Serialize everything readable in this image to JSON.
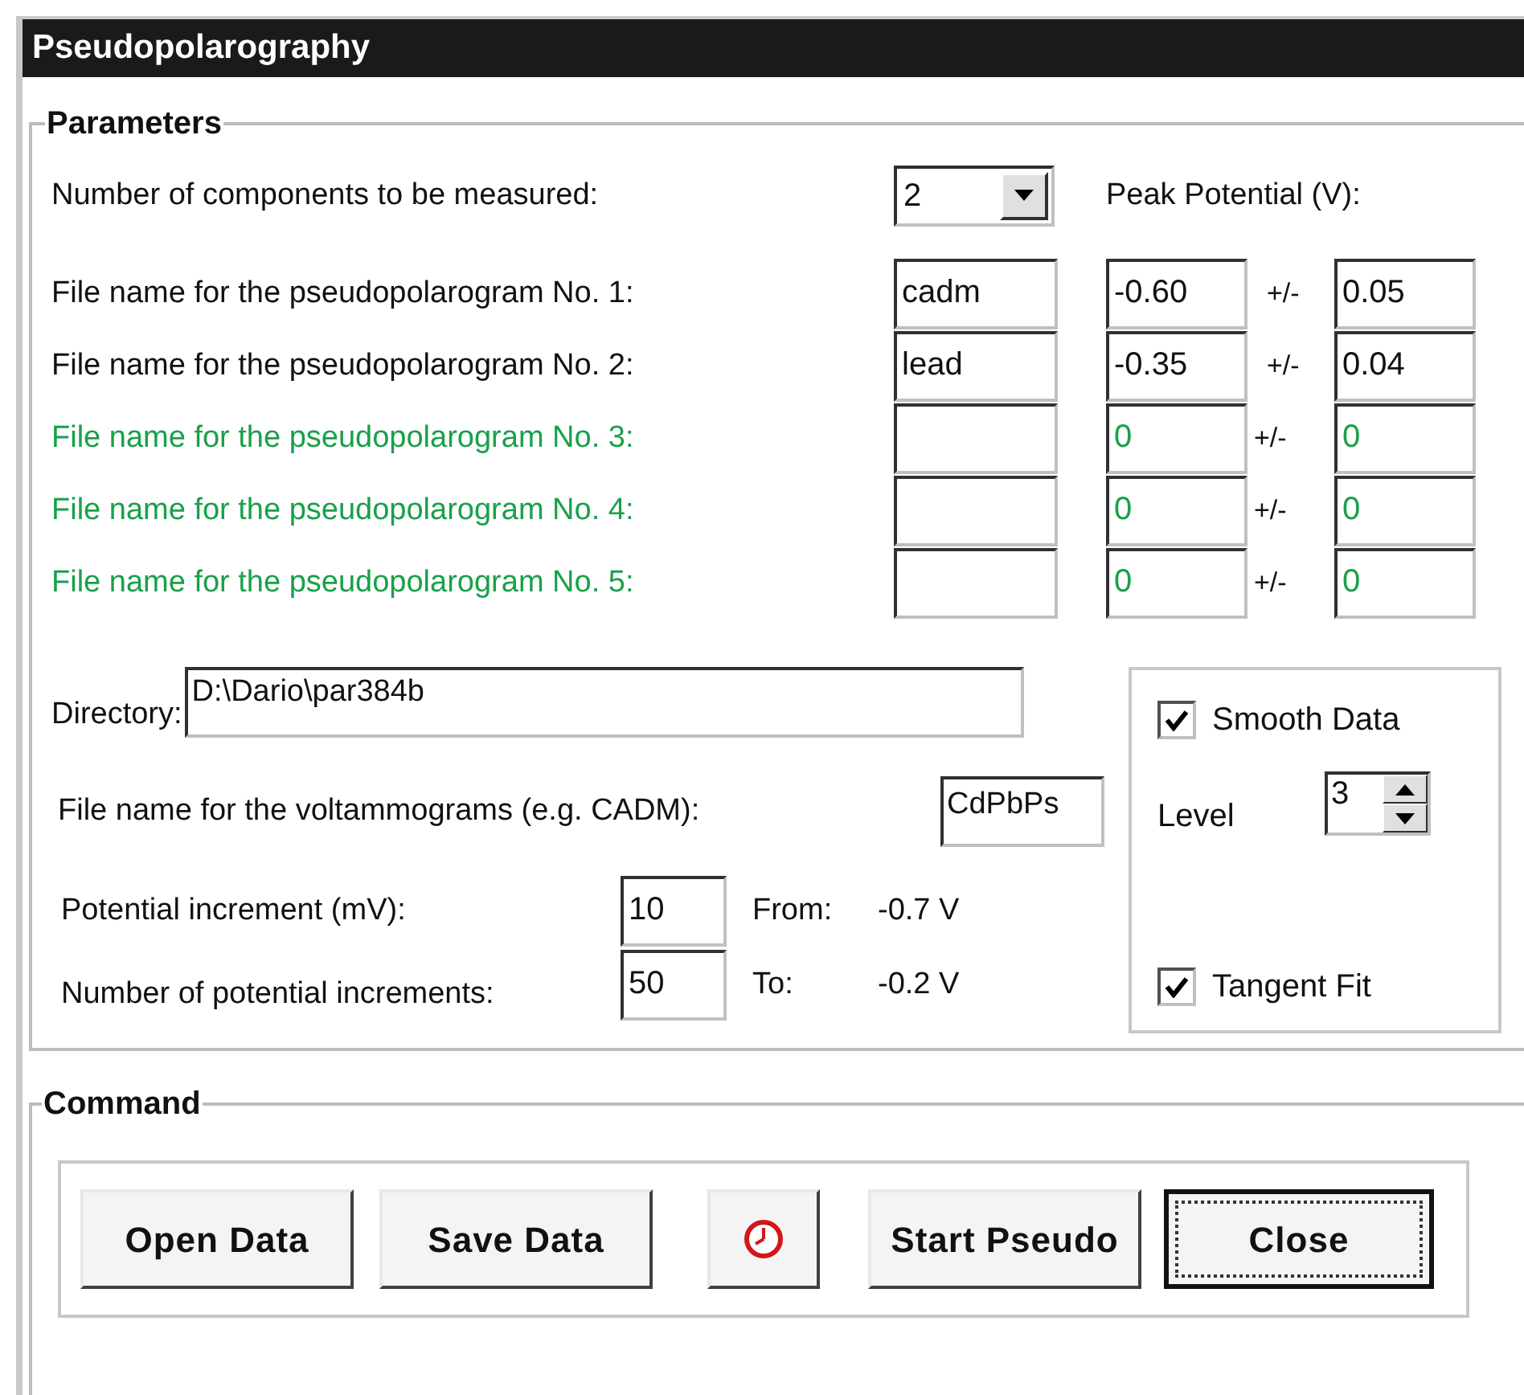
{
  "window": {
    "title": "Pseudopolarography"
  },
  "parameters": {
    "title": "Parameters",
    "components": {
      "label": "Number of components to be measured:",
      "value": "2"
    },
    "peak_header": "Peak Potential (V):",
    "files": [
      {
        "label": "File name for the pseudopolarogram No. 1:",
        "file": "cadm",
        "peak": "-0.60",
        "separator": "+/-",
        "tolerance": "0.05",
        "disabled": false
      },
      {
        "label": "File name for the pseudopolarogram No. 2:",
        "file": "lead",
        "peak": "-0.35",
        "separator": "+/-",
        "tolerance": "0.04",
        "disabled": false
      },
      {
        "label": "File name for the pseudopolarogram No. 3:",
        "peak": "0",
        "separator": "+/-",
        "tolerance": "0",
        "disabled": true
      },
      {
        "label": "File name for the pseudopolarogram No. 4:",
        "peak": "0",
        "separator": "+/-",
        "tolerance": "0",
        "disabled": true
      },
      {
        "label": "File name for the pseudopolarogram No. 5:",
        "peak": "0",
        "separator": "+/-",
        "tolerance": "0",
        "disabled": true
      }
    ],
    "directory": {
      "label": "Directory:",
      "value": "D:\\Dario\\par384b"
    },
    "voltammograms": {
      "label": "File name for the voltammograms (e.g. CADM):",
      "value": "CdPbPs"
    },
    "increment": {
      "label": "Potential increment (mV):",
      "value": "10",
      "range_label": "From:",
      "range_value": "-0.7 V"
    },
    "increments_count": {
      "label": "Number of potential increments:",
      "value": "50",
      "range_label": "To:",
      "range_value": "-0.2 V"
    },
    "smooth": {
      "label": "Smooth Data",
      "checked": true
    },
    "level": {
      "label": "Level",
      "value": "3"
    },
    "tangent": {
      "label": "Tangent Fit",
      "checked": true
    }
  },
  "command": {
    "title": "Command",
    "buttons": [
      {
        "kind": "text",
        "label": "Open Data",
        "focused": false
      },
      {
        "kind": "text",
        "label": "Save Data",
        "focused": false
      },
      {
        "kind": "timer",
        "focused": false
      },
      {
        "kind": "text",
        "label": "Start Pseudo",
        "focused": false
      },
      {
        "kind": "text",
        "label": "Close",
        "focused": true
      }
    ]
  }
}
